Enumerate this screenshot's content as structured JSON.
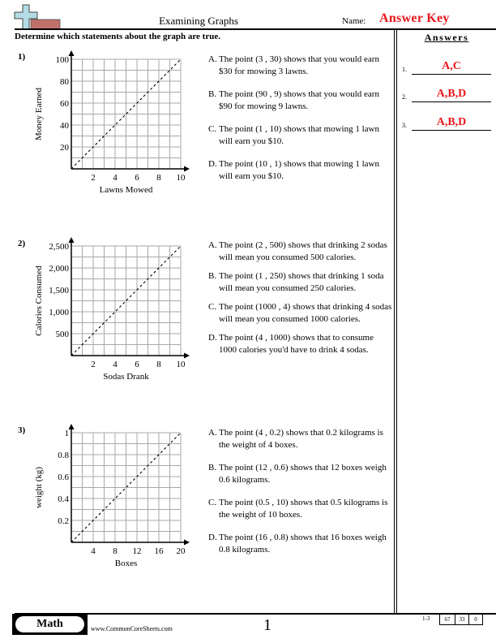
{
  "header": {
    "title": "Examining Graphs",
    "name_label": "Name:",
    "name_value": "Answer Key",
    "instructions": "Determine which statements about the graph are true.",
    "logo_icon": "plus-sign-logo-icon"
  },
  "answers_panel": {
    "title": "Answers",
    "items": [
      {
        "num": "1.",
        "value": "A,C"
      },
      {
        "num": "2.",
        "value": "A,B,D"
      },
      {
        "num": "3.",
        "value": "A,B,D"
      }
    ]
  },
  "questions": [
    {
      "number": "1)",
      "statements": [
        {
          "letter": "A.",
          "text": "The point (3 , 30) shows that you would earn $30 for mowing 3 lawns."
        },
        {
          "letter": "B.",
          "text": "The point (90 , 9) shows that you would earn $90 for mowing 9 lawns."
        },
        {
          "letter": "C.",
          "text": "The point (1 , 10) shows that mowing 1 lawn will earn you $10."
        },
        {
          "letter": "D.",
          "text": "The point (10 , 1) shows that mowing 1 lawn will earn you $10."
        }
      ]
    },
    {
      "number": "2)",
      "statements": [
        {
          "letter": "A.",
          "text": "The point (2 , 500) shows that drinking 2 sodas will mean you consumed 500 calories."
        },
        {
          "letter": "B.",
          "text": "The point (1 , 250) shows that drinking 1 soda will mean you consumed 250 calories."
        },
        {
          "letter": "C.",
          "text": "The point (1000 , 4) shows that drinking 4 sodas will mean you consumed 1000 calories."
        },
        {
          "letter": "D.",
          "text": "The point (4 , 1000) shows that to consume 1000 calories you'd have to drink 4 sodas."
        }
      ]
    },
    {
      "number": "3)",
      "statements": [
        {
          "letter": "A.",
          "text": "The point (4 , 0.2) shows that 0.2 kilograms is the weight of 4 boxes."
        },
        {
          "letter": "B.",
          "text": "The point (12 , 0.6) shows that 12 boxes weigh 0.6 kilograms."
        },
        {
          "letter": "C.",
          "text": "The point (0.5 , 10) shows that 0.5 kilograms is the weight of 10 boxes."
        },
        {
          "letter": "D.",
          "text": "The point (16 , 0.8) shows that 16 boxes weigh 0.8 kilograms."
        }
      ]
    }
  ],
  "chart_data": [
    {
      "type": "line",
      "title": "",
      "xlabel": "Lawns Mowed",
      "ylabel": "Money Earned",
      "xlim": [
        0,
        10
      ],
      "ylim": [
        0,
        100
      ],
      "xticks": [
        2,
        4,
        6,
        8,
        10
      ],
      "xtick_labels": [
        "2",
        "4",
        "6",
        "8",
        "10"
      ],
      "yticks": [
        20,
        40,
        60,
        80,
        100
      ],
      "ytick_labels": [
        "20",
        "40",
        "60",
        "80",
        "100"
      ],
      "grid_divisions": 10,
      "grid": true,
      "series": [
        {
          "name": "line",
          "style": "dashed",
          "x": [
            0,
            10
          ],
          "y": [
            0,
            100
          ]
        }
      ]
    },
    {
      "type": "line",
      "title": "",
      "xlabel": "Sodas Drank",
      "ylabel": "Calories Consumed",
      "xlim": [
        0,
        10
      ],
      "ylim": [
        0,
        2500
      ],
      "xticks": [
        2,
        4,
        6,
        8,
        10
      ],
      "xtick_labels": [
        "2",
        "4",
        "6",
        "8",
        "10"
      ],
      "yticks": [
        500,
        1000,
        1500,
        2000,
        2500
      ],
      "ytick_labels": [
        "500",
        "1,000",
        "1,500",
        "2,000",
        "2,500"
      ],
      "grid_divisions": 10,
      "grid": true,
      "series": [
        {
          "name": "line",
          "style": "dashed",
          "x": [
            0,
            10
          ],
          "y": [
            0,
            2500
          ]
        }
      ]
    },
    {
      "type": "line",
      "title": "",
      "xlabel": "Boxes",
      "ylabel": "weight (kg)",
      "xlim": [
        0,
        20
      ],
      "ylim": [
        0,
        1
      ],
      "xticks": [
        4,
        8,
        12,
        16,
        20
      ],
      "xtick_labels": [
        "4",
        "8",
        "12",
        "16",
        "20"
      ],
      "yticks": [
        0.2,
        0.4,
        0.6,
        0.8,
        1
      ],
      "ytick_labels": [
        "0.2",
        "0.4",
        "0.6",
        "0.8",
        "1"
      ],
      "grid_divisions": 10,
      "grid": true,
      "series": [
        {
          "name": "line",
          "style": "dashed",
          "x": [
            0,
            20
          ],
          "y": [
            0,
            1
          ]
        }
      ]
    }
  ],
  "footer": {
    "subject": "Math",
    "website": "www.CommonCoreSheets.com",
    "page_number": "1",
    "range": "1-3",
    "scores": [
      "67",
      "33",
      "0"
    ]
  }
}
